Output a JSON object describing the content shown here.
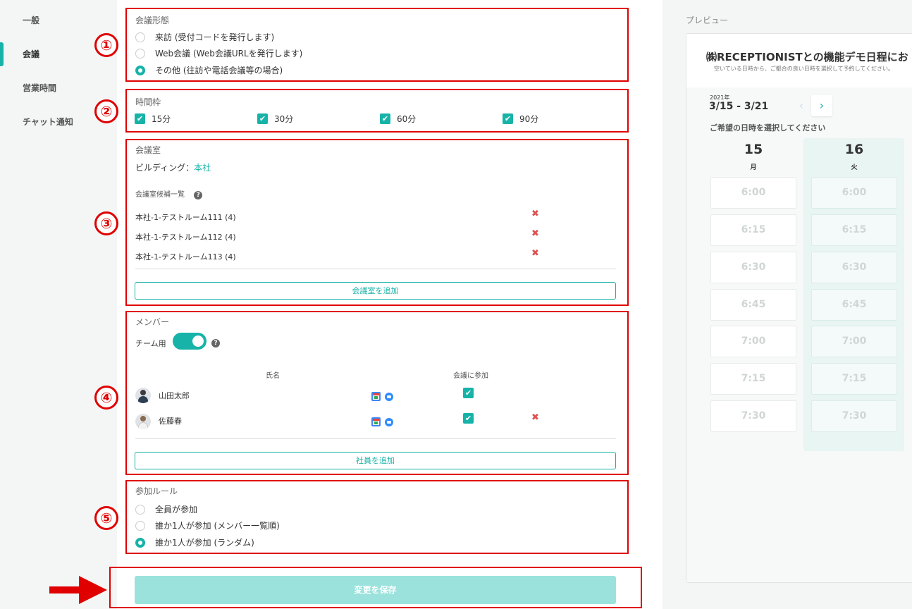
{
  "sidebar": {
    "items": [
      {
        "label": "一般"
      },
      {
        "label": "会議"
      },
      {
        "label": "営業時間"
      },
      {
        "label": "チャット通知"
      }
    ]
  },
  "sections": {
    "meeting_type": {
      "number": "①",
      "title": "会議形態",
      "options": [
        {
          "label": "来訪 (受付コードを発行します)",
          "selected": false
        },
        {
          "label": "Web会議 (Web会議URLを発行します)",
          "selected": false
        },
        {
          "label": "その他 (往訪や電話会議等の場合)",
          "selected": true
        }
      ]
    },
    "time_slot": {
      "number": "②",
      "title": "時間枠",
      "options": [
        {
          "label": "15分",
          "checked": true
        },
        {
          "label": "30分",
          "checked": true
        },
        {
          "label": "60分",
          "checked": true
        },
        {
          "label": "90分",
          "checked": true
        }
      ]
    },
    "room": {
      "number": "③",
      "title": "会議室",
      "building_label": "ビルディング：",
      "building_value": "本社",
      "candidates_label": "会議室候補一覧",
      "rooms": [
        {
          "name": "本社-1-テストルーム111 (4)"
        },
        {
          "name": "本社-1-テストルーム112 (4)"
        },
        {
          "name": "本社-1-テストルーム113 (4)"
        }
      ],
      "add_button": "会議室を追加"
    },
    "members": {
      "number": "④",
      "title": "メンバー",
      "team_label": "チーム用",
      "team_enabled": true,
      "col_name": "氏名",
      "col_join": "会議に参加",
      "rows": [
        {
          "name": "山田太郎",
          "joined": true,
          "deletable": false
        },
        {
          "name": "佐藤春",
          "joined": true,
          "deletable": true
        }
      ],
      "add_button": "社員を追加"
    },
    "rule": {
      "number": "⑤",
      "title": "参加ルール",
      "options": [
        {
          "label": "全員が参加",
          "selected": false
        },
        {
          "label": "誰か1人が参加 (メンバー一覧順)",
          "selected": false
        },
        {
          "label": "誰か1人が参加 (ランダム)",
          "selected": true
        }
      ]
    }
  },
  "save_button": "変更を保存",
  "help_glyph": "?",
  "delete_glyph": "✖",
  "check_glyph": "✔",
  "preview": {
    "label": "プレビュー",
    "title": "㈱RECEPTIONISTとの機能デモ日程にお",
    "subtitle": "空いている日時から、ご都合の良い日時を選択して予約してください。",
    "year": "2021年",
    "range": "3/15 - 3/21",
    "prev_glyph": "‹",
    "next_glyph": "›",
    "hint": "ご希望の日時を選択してください",
    "days": [
      {
        "date": "15",
        "weekday": "月",
        "slots": [
          "6:00",
          "6:15",
          "6:30",
          "6:45",
          "7:00",
          "7:15",
          "7:30"
        ]
      },
      {
        "date": "16",
        "weekday": "火",
        "slots": [
          "6:00",
          "6:15",
          "6:30",
          "6:45",
          "7:00",
          "7:15",
          "7:30"
        ]
      }
    ]
  },
  "colors": {
    "accent": "#17b3a8",
    "annotation": "#e00000",
    "save_disabled": "#9be2dd"
  }
}
